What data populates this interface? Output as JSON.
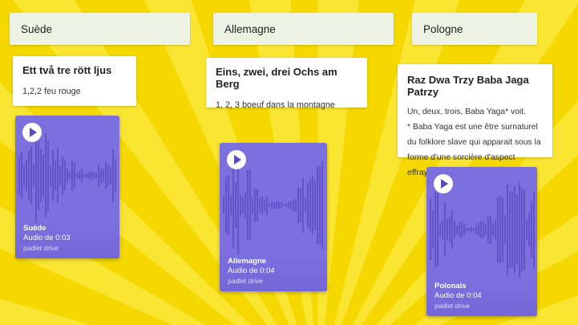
{
  "columns": [
    {
      "header": "Suède",
      "note_title": "Ett två tre rött ljus",
      "note_body": "1,2,2 feu rouge",
      "audio": {
        "name": "Suède",
        "duration": "Audio de 0:03",
        "source": "padlet drive"
      }
    },
    {
      "header": "Allemagne",
      "note_title": "Eins, zwei, drei Ochs am Berg",
      "note_body": "1, 2, 3 boeuf dans la montagne",
      "audio": {
        "name": "Allemagne",
        "duration": "Audio de 0:04",
        "source": "padlet drive"
      }
    },
    {
      "header": "Pologne",
      "note_title": "Raz Dwa Trzy Baba Jaga Patrzy",
      "note_body": "Un, deux, trois, Baba Yaga* voit.\n* Baba Yaga est une être surnaturel du folklore slave qui apparait sous la forme d'une sorcière d'aspect effrayant.",
      "audio": {
        "name": "Polonais",
        "duration": "Audio de 0:04",
        "source": "padlet drive"
      }
    }
  ],
  "icons": {
    "play": "play-icon",
    "waveform": "waveform-icon"
  },
  "colors": {
    "background": "#f4d800",
    "header_card": "#eef2e2",
    "audio_card": "#7c6fde",
    "waveform": "#6253c9"
  }
}
